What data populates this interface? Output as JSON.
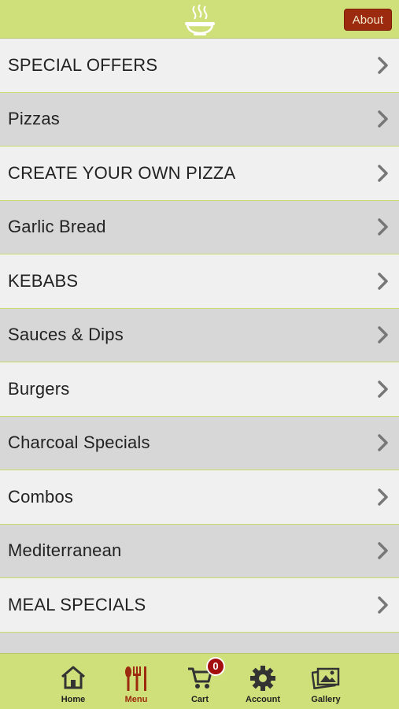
{
  "header": {
    "about_label": "About",
    "logo_icon": "noodle-bowl-icon"
  },
  "menu": {
    "items": [
      {
        "label": "SPECIAL OFFERS"
      },
      {
        "label": "Pizzas"
      },
      {
        "label": "CREATE YOUR OWN PIZZA"
      },
      {
        "label": "Garlic Bread"
      },
      {
        "label": "KEBABS"
      },
      {
        "label": "Sauces & Dips"
      },
      {
        "label": "Burgers"
      },
      {
        "label": "Charcoal Specials"
      },
      {
        "label": "Combos"
      },
      {
        "label": "Mediterranean"
      },
      {
        "label": "MEAL SPECIALS"
      }
    ]
  },
  "tabs": [
    {
      "label": "Home",
      "icon": "home-icon"
    },
    {
      "label": "Menu",
      "icon": "utensils-icon",
      "active": true
    },
    {
      "label": "Cart",
      "icon": "cart-icon",
      "badge": "0"
    },
    {
      "label": "Account",
      "icon": "gear-icon"
    },
    {
      "label": "Gallery",
      "icon": "gallery-icon"
    }
  ],
  "colors": {
    "bar": "#cfe07a",
    "accent": "#9b2a0e",
    "row_light": "#f0f0f0",
    "row_dark": "#d7d7d7",
    "badge": "#a30d0d"
  }
}
